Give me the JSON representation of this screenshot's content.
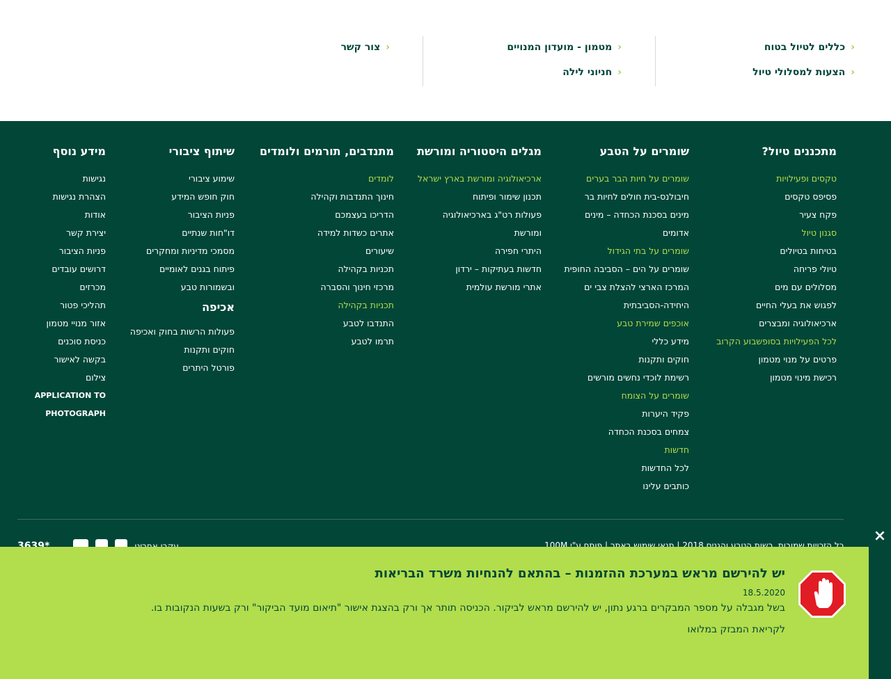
{
  "top_links": {
    "col1": [
      "כללים לטיול בטוח",
      "הצעות למסלולי טיול"
    ],
    "col2": [
      "מטמון - מועדון המנויים",
      "חניוני לילה"
    ],
    "col3": [
      "צור קשר"
    ]
  },
  "footer": {
    "col_plan": {
      "title": "מתכננים טיול?",
      "items": [
        "טקסים ופעילויות",
        "פסיפס טקסים",
        "פקח צעיר",
        "סגנון טיול",
        "בטיחות בטיולים",
        "טיולי פריחה",
        "מסלולים עם מים",
        "לפגוש את בעלי החיים",
        "ארכיאולוגיה ומבצרים",
        "לכל הפעילויות בסופשבוע הקרוב",
        "פרטים על מנוי מטמון",
        "רכישת מינוי מטמון"
      ]
    },
    "col_nature": {
      "title": "שומרים על הטבע",
      "items": [
        "שומרים על חיות הבר בערים",
        "חיבולנס-בית חולים לחיות בר",
        "מינים בסכנת הכחדה – מינים",
        "אדומים",
        "שומרים על בתי הגידול",
        "שומרים על הים – הסביבה החופית",
        "המרכז הארצי להצלת צבי ים",
        "היחידה-הסביבתית",
        "אוכפים שמירת טבע",
        "מידע כללי",
        "חוקים ותקנות",
        "רשימת לוכדי נחשים מורשים",
        "שומרים על הצומח",
        "פקיד היערות",
        "צמחים בסכנת הכחדה",
        "חדשות",
        "לכל החדשות",
        "כותבים עלינו"
      ]
    },
    "col_history": {
      "title": "מגלים היסטוריה ומורשת",
      "items": [
        "ארכיאולוגיה ומורשת בארץ ישראל",
        "תכנון שימור ופיתוח",
        "פעולות רט\"ג בארכיאולוגיה",
        "ומורשת",
        "היתרי חפירה",
        "חדשות בעתיקות – ירדון",
        "אתרי מורשת עולמית"
      ]
    },
    "col_volunteer": {
      "title": "מתנדבים, תורמים ולומדים",
      "items": [
        "לומדים",
        "חינוך התנדבות וקהילה",
        "הדריכו בעצמכם",
        "אתרים כשדות למידה",
        "שיעורים",
        "תכניות בקהילה",
        "מרכזי חינוך והסברה",
        "תכניות בקהילה",
        "התנדבו לטבע",
        "תרמו לטבע"
      ]
    },
    "col_public": {
      "title": "שיתוף ציבורי",
      "items": [
        "שימוע ציבורי",
        "חוק חופש המידע",
        "פניות הציבור",
        "דו\"חות שנתיים",
        "מסמכי מדיניות ומחקרים",
        "פיתוח בגנים לאומיים",
        "ובשמורות טבע"
      ],
      "sub_title": "אכיפה",
      "sub_items": [
        "פעולות הרשות בחוק ואכיפה",
        "חוקים ותקנות",
        "פורטל היתרים"
      ]
    },
    "col_more": {
      "title": "מידע נוסף",
      "items": [
        "נגישות",
        "הצהרת נגישות",
        "אודות",
        "יצירת קשר",
        "פניות הציבור",
        "דרושים עובדים",
        "מכרזים",
        "תהליכי פטור",
        "אזור מנויי מטמון",
        "כניסת סוכנים",
        "בקשה לאישור",
        "צילום",
        "APPLICATION TO",
        "PHOTOGRAPH"
      ]
    },
    "legal": "כל הזכויות שמורות, רשות הטבע והגנים 2018 | תנאי שימוש באתר | פותח ע\"י 100M",
    "social_label": "עקבו אחרינו",
    "phone": "3639*"
  },
  "banner": {
    "title": "יש להירשם מראש במערכת ההזמנות – בהתאם להנחיות משרד הבריאות",
    "date": "18.5.2020",
    "text": "בשל מגבלה על מספר המבקרים ברגע נתון, יש להירשם מראש לביקור. הכניסה תותר אך ורק בהצגת אישור \"תיאום מועד הביקור\" ורק בשעות הנקובות בו.",
    "link": "לקריאת המבזק במלואו",
    "close": "×"
  },
  "colors": {
    "dark_green": "#024638",
    "lime": "#b2dd4c",
    "accent_link": "#9fd34a"
  }
}
